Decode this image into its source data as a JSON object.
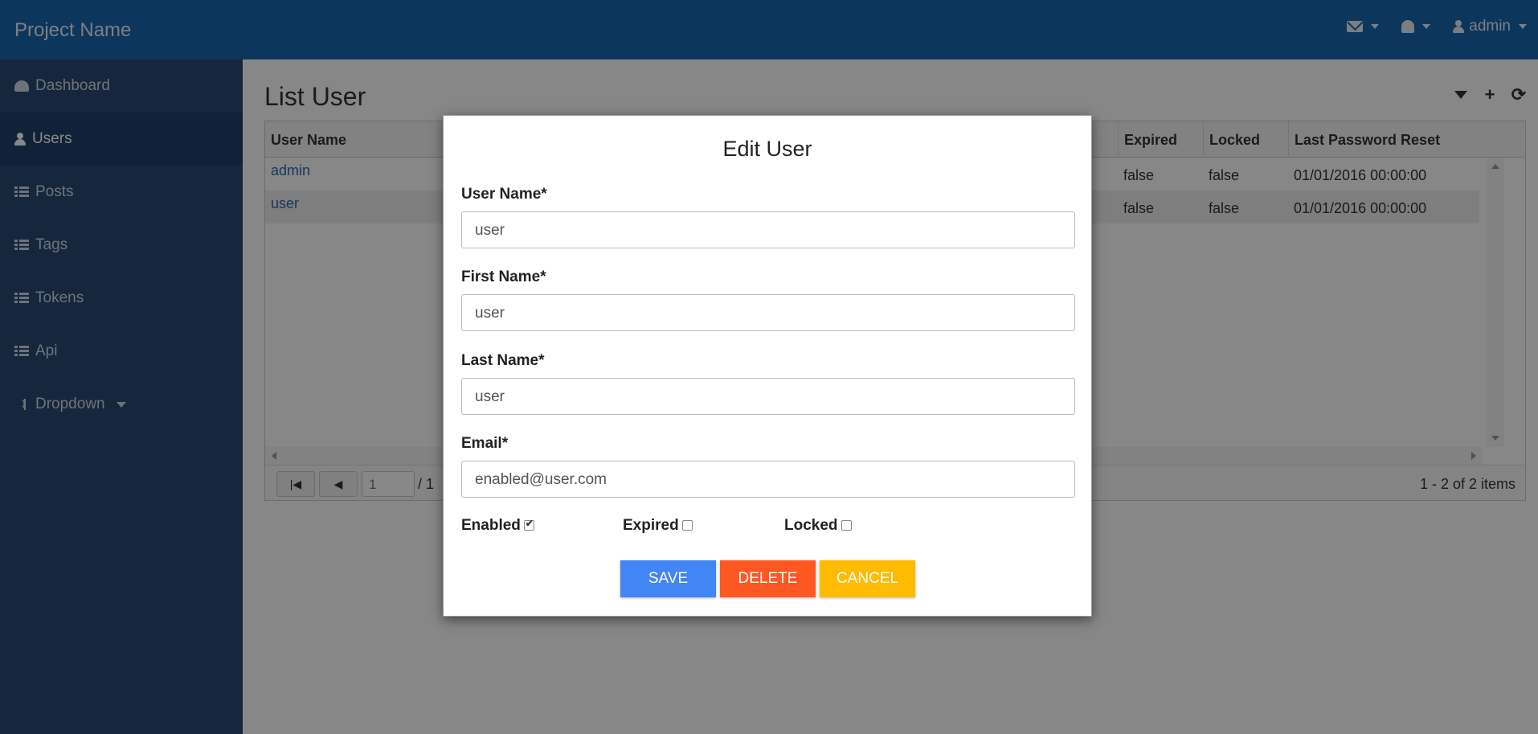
{
  "navbar": {
    "brand": "Project Name",
    "user": "admin",
    "icons": [
      "envelope-icon",
      "bell-icon",
      "user-icon"
    ]
  },
  "sidebar": {
    "items": [
      {
        "label": "Dashboard",
        "icon": "dashboard-icon"
      },
      {
        "label": "Users",
        "icon": "user-icon",
        "active": true
      },
      {
        "label": "Posts",
        "icon": "list-icon"
      },
      {
        "label": "Tags",
        "icon": "list-icon"
      },
      {
        "label": "Tokens",
        "icon": "list-icon"
      },
      {
        "label": "Api",
        "icon": "list-icon"
      },
      {
        "label": "Dropdown",
        "icon": "updown-icon"
      }
    ]
  },
  "main": {
    "title": "List User",
    "tools": [
      "filter-icon",
      "plus-icon",
      "refresh-icon"
    ],
    "grid": {
      "columns": [
        "User Name",
        "Expired",
        "Locked",
        "Last Password Reset"
      ],
      "rows": [
        {
          "username": "admin",
          "expired": "false",
          "locked": "false",
          "reset": "01/01/2016 00:00:00"
        },
        {
          "username": "user",
          "expired": "false",
          "locked": "false",
          "reset": "01/01/2016 00:00:00"
        }
      ],
      "pager": {
        "page": "1",
        "total_pages": "/ 1",
        "info": "1 - 2 of 2 items"
      }
    }
  },
  "modal": {
    "title": "Edit User",
    "fields": {
      "username": {
        "label": "User Name*",
        "value": "user"
      },
      "firstname": {
        "label": "First Name*",
        "value": "user"
      },
      "lastname": {
        "label": "Last Name*",
        "value": "user"
      },
      "email": {
        "label": "Email*",
        "value": "enabled@user.com"
      }
    },
    "checks": {
      "enabled": {
        "label": "Enabled",
        "checked": true
      },
      "expired": {
        "label": "Expired",
        "checked": false
      },
      "locked": {
        "label": "Locked",
        "checked": false
      }
    },
    "buttons": {
      "save": "SAVE",
      "delete": "DELETE",
      "cancel": "CANCEL"
    }
  },
  "colors": {
    "navbar": "#1a66b0",
    "sidebar": "#2a4a73",
    "save": "#4285f4",
    "delete": "#ff5722",
    "cancel": "#ffbb00"
  }
}
